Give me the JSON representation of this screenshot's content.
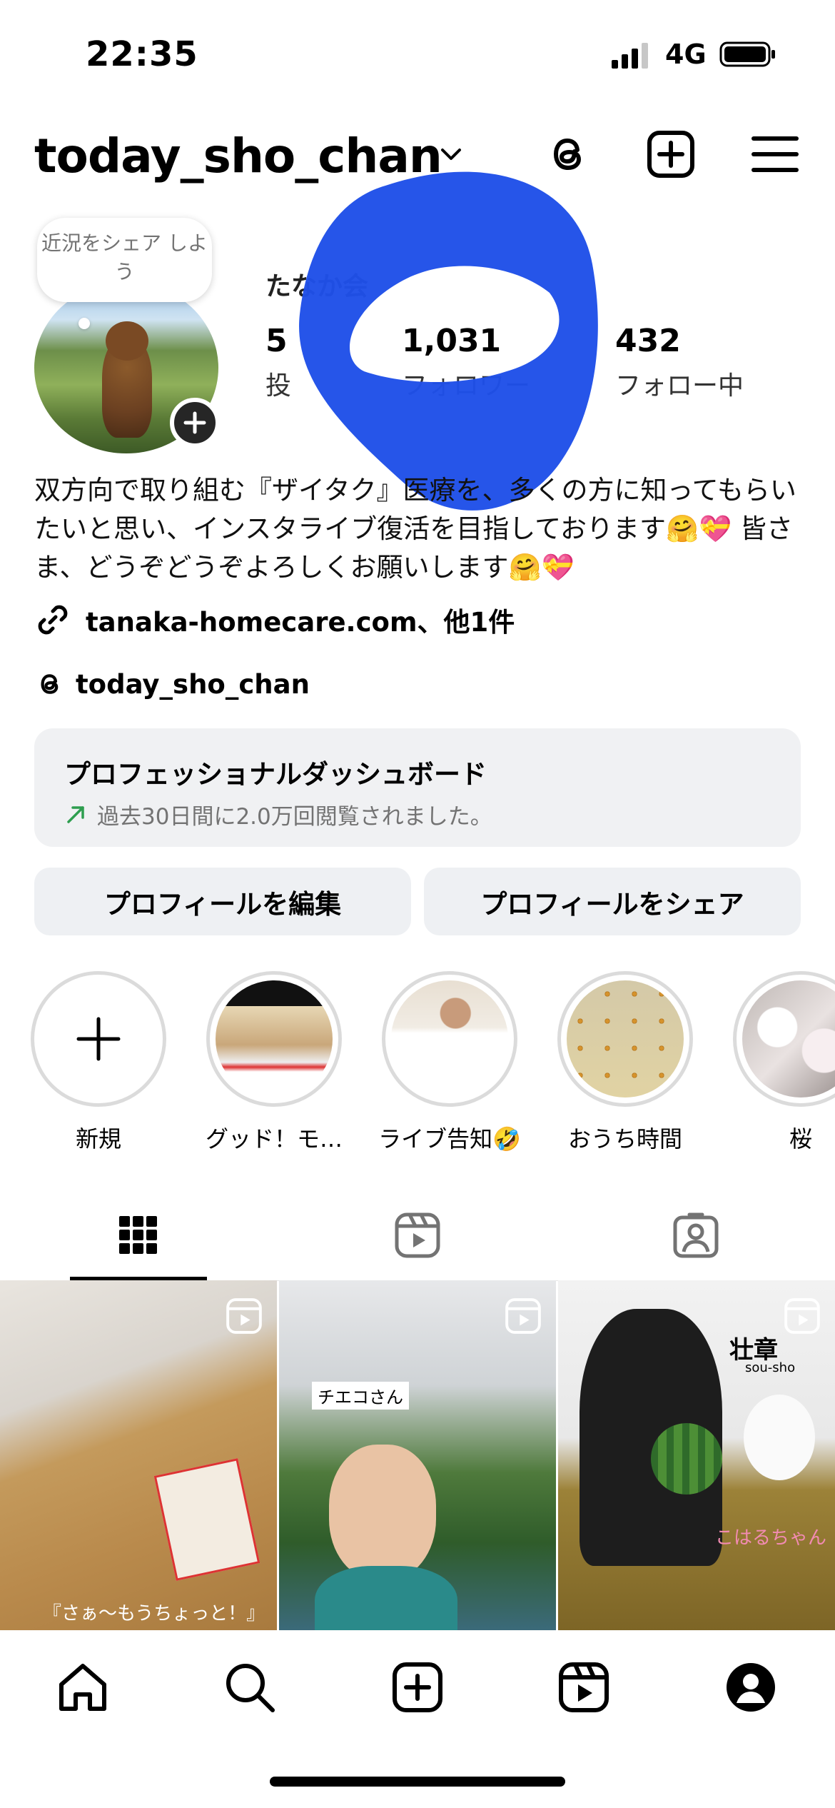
{
  "status_bar": {
    "time": "22:35",
    "network": "4G"
  },
  "header": {
    "username": "today_sho_chan"
  },
  "profile": {
    "note": "近況をシェア しよう",
    "display_name": "たなか会",
    "stats": [
      {
        "value": "5",
        "label": "投"
      },
      {
        "value": "1,031",
        "label": "フォロワー"
      },
      {
        "value": "432",
        "label": "フォロー中"
      }
    ],
    "bio": "双方向で取り組む『ザイタク』医療を、多くの方に知ってもらいたいと思い、インスタライブ復活を目指しております🤗💝 皆さま、どうぞどうぞよろしくお願いします🤗💝",
    "link": "tanaka-homecare.com、他1件",
    "threads_handle": "today_sho_chan"
  },
  "dashboard": {
    "title": "プロフェッショナルダッシュボード",
    "subtitle": "過去30日間に2.0万回閲覧されました。"
  },
  "buttons": {
    "edit": "プロフィールを編集",
    "share": "プロフィールをシェア"
  },
  "highlights": [
    {
      "label": "新規"
    },
    {
      "label": "グッド！モ…"
    },
    {
      "label": "ライブ告知🤣"
    },
    {
      "label": "おうち時間"
    },
    {
      "label": "桜"
    }
  ],
  "grid": {
    "post1_caption": "『さぁ〜もうちょっと！』",
    "post2_tag": "チエコさん",
    "post3_sign": "壮章",
    "post3_sign_sub": "sou-sho",
    "post3_caption": "こはるちゃん"
  },
  "colors": {
    "scribble": "#1f4fe8",
    "trend_arrow": "#2e9e4f"
  }
}
